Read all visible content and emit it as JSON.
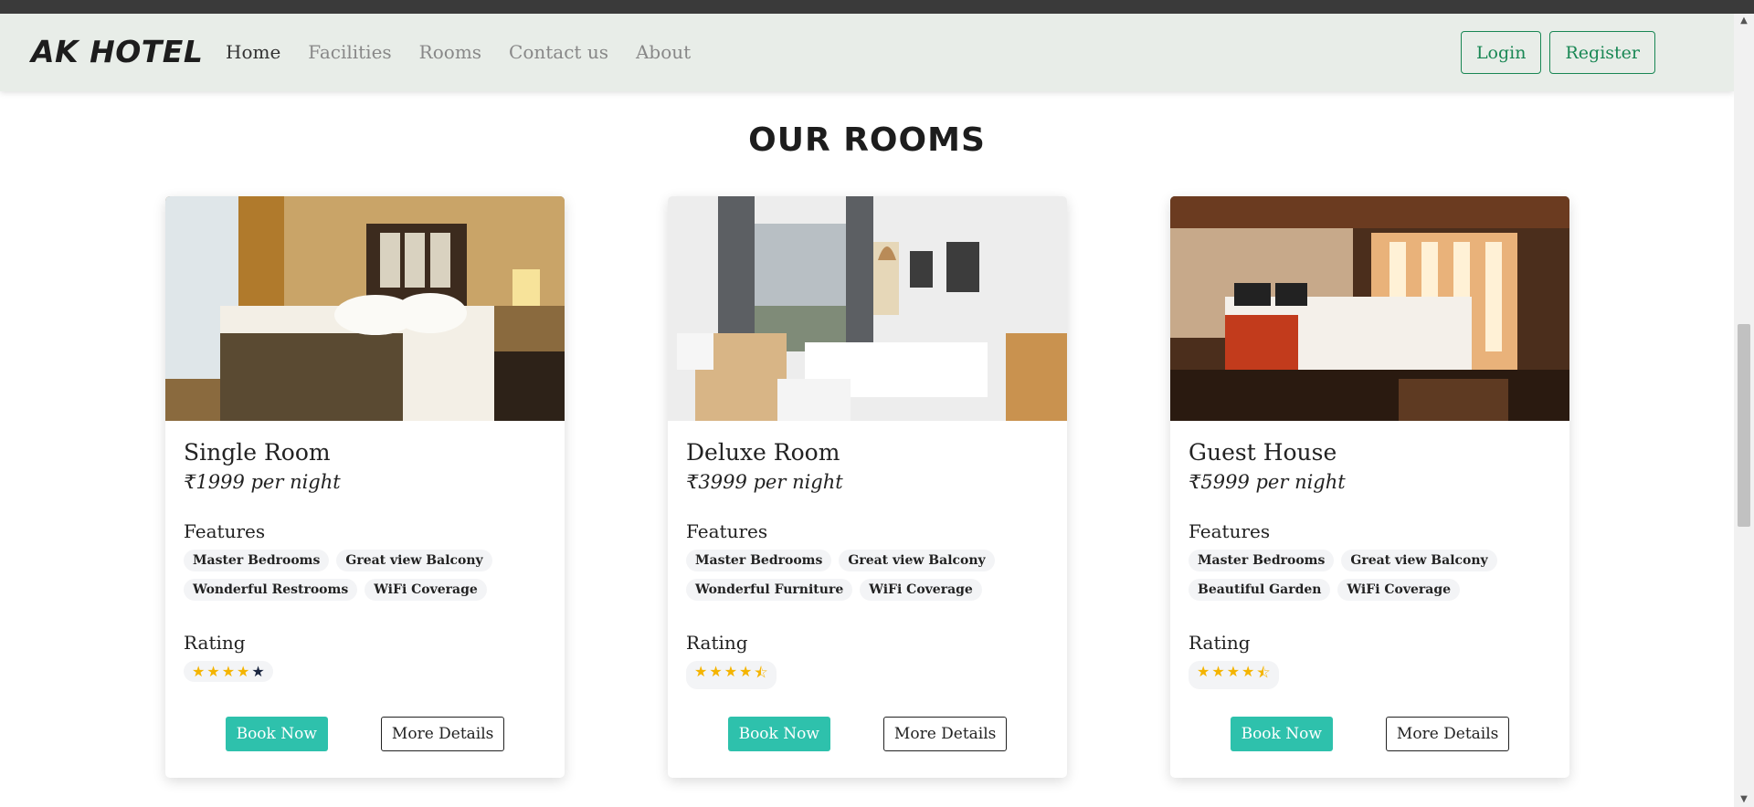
{
  "brand": "AK HOTEL",
  "nav": [
    {
      "label": "Home",
      "active": true
    },
    {
      "label": "Facilities",
      "active": false
    },
    {
      "label": "Rooms",
      "active": false
    },
    {
      "label": "Contact us",
      "active": false
    },
    {
      "label": "About",
      "active": false
    }
  ],
  "auth": {
    "login": "Login",
    "register": "Register"
  },
  "section_title": "OUR ROOMS",
  "labels": {
    "features": "Features",
    "rating": "Rating",
    "book": "Book Now",
    "details": "More Details"
  },
  "rooms": [
    {
      "name": "Single Room",
      "price": "₹1999 per night",
      "features": [
        "Master Bedrooms",
        "Great view Balcony",
        "Wonderful Restrooms",
        "WiFi Coverage"
      ],
      "rating": 4
    },
    {
      "name": "Deluxe Room",
      "price": "₹3999 per night",
      "features": [
        "Master Bedrooms",
        "Great view Balcony",
        "Wonderful Furniture",
        "WiFi Coverage"
      ],
      "rating": 4.5
    },
    {
      "name": "Guest House",
      "price": "₹5999 per night",
      "features": [
        "Master Bedrooms",
        "Great view Balcony",
        "Beautiful Garden",
        "WiFi Coverage"
      ],
      "rating": 4.5
    }
  ],
  "colors": {
    "accent": "#2ec1ac",
    "brand_green": "#198754",
    "star": "#f4b400"
  }
}
